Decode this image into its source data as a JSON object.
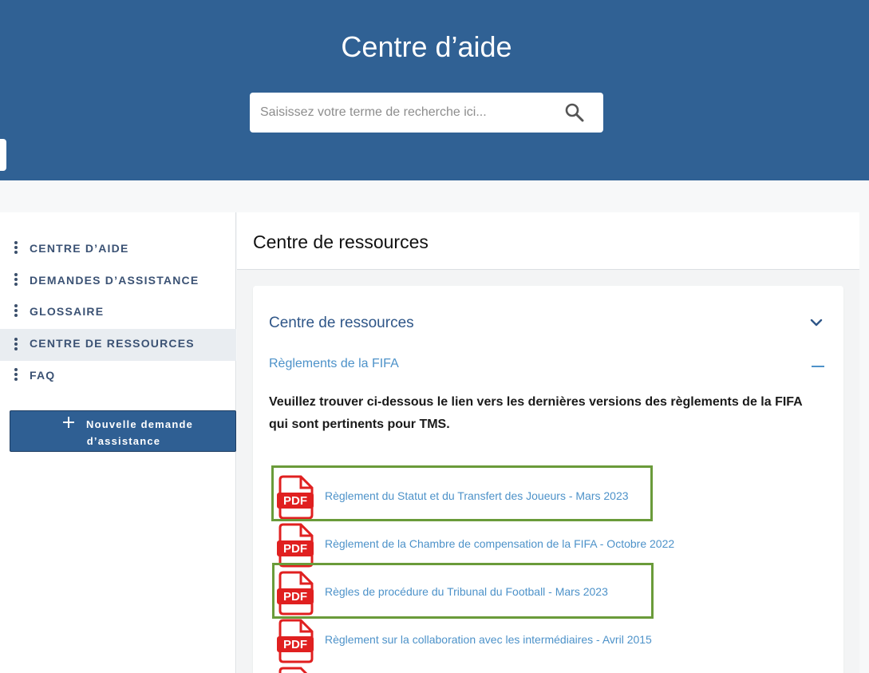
{
  "header": {
    "title": "Centre d’aide",
    "search_placeholder": "Saisissez votre terme de recherche ici..."
  },
  "sidebar": {
    "items": [
      {
        "label": "CENTRE D’AIDE",
        "active": false
      },
      {
        "label": "DEMANDES D’ASSISTANCE",
        "active": false
      },
      {
        "label": "GLOSSAIRE",
        "active": false
      },
      {
        "label": "CENTRE DE RESSOURCES",
        "active": true
      },
      {
        "label": "FAQ",
        "active": false
      }
    ],
    "new_request": {
      "line1": "Nouvelle demande",
      "line2": "d’assistance"
    }
  },
  "main": {
    "title": "Centre de ressources",
    "section_title": "Centre de ressources",
    "subsection_title": "Règlements de la FIFA",
    "intro": "Veuillez trouver ci-dessous le lien vers les dernières versions des règlements de la FIFA qui sont pertinents pour TMS.",
    "pdf_badge": "PDF",
    "documents": [
      {
        "label": "Règlement du Statut et du Transfert des Joueurs - Mars 2023",
        "highlighted": true
      },
      {
        "label": "Règlement de la Chambre de compensation de la FIFA - Octobre 2022",
        "highlighted": false
      },
      {
        "label": "Règles de procédure du Tribunal du Football - Mars 2023",
        "highlighted": true
      },
      {
        "label": "Règlement sur la collaboration avec les intermédiaires - Avril 2015",
        "highlighted": false
      }
    ]
  },
  "colors": {
    "header_bg": "#306194",
    "accent": "#4d92c9",
    "highlight_border": "#6a9b3a",
    "pdf_red": "#e02020"
  }
}
